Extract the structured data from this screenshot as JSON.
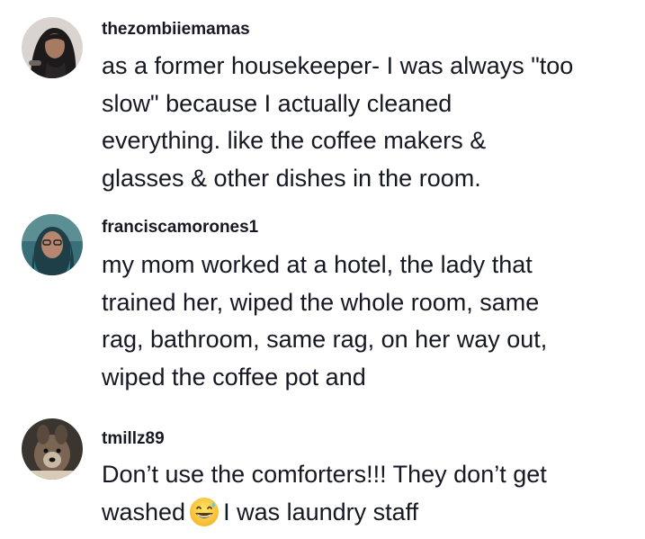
{
  "comments": [
    {
      "username": "thezombiiemamas",
      "text_lines": [
        "as a former housekeeper- I was always \"too",
        "slow\" because I actually cleaned",
        "everything. like the coffee makers &",
        "glasses & other dishes in the room."
      ],
      "avatar_icon": "user-avatar-photo"
    },
    {
      "username": "franciscamorones1",
      "text_lines": [
        "my mom worked at a hotel, the lady that",
        "trained her, wiped the whole room, same",
        "rag, bathroom, same rag, on her way out,",
        "wiped the coffee pot and"
      ],
      "avatar_icon": "user-avatar-photo"
    },
    {
      "username": "tmillz89",
      "text_lines": [
        "Don’t use the comforters!!! They don’t get"
      ],
      "last_line_before_emoji": "washed",
      "last_line_after_emoji": "I was laundry staff",
      "emoji_icon": "grinning-sweat-emoji",
      "avatar_icon": "user-avatar-photo"
    }
  ]
}
